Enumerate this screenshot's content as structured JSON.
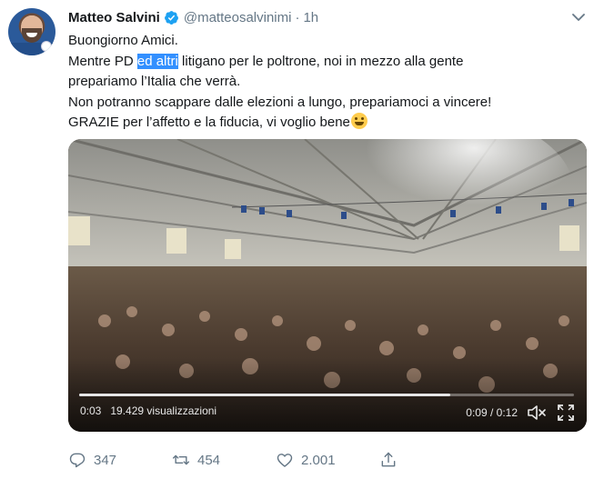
{
  "tweet": {
    "author_name": "Matteo Salvini",
    "handle": "@matteosalvinimi",
    "separator": "·",
    "time": "1h",
    "text": {
      "line1": "Buongiorno Amici.",
      "line2_before": "Mentre PD ",
      "line2_highlight": "ed altri",
      "line2_after": " litigano per le poltrone, noi in mezzo alla gente",
      "line3": "prepariamo l’Italia che verrà.",
      "line4": "Non potranno scappare dalle elezioni a lungo, prepariamoci a vincere!",
      "line5": "GRAZIE per l’affetto e la fiducia, vi voglio bene"
    },
    "emoji": "smiling-face-emoji"
  },
  "video": {
    "current_time": "0:03",
    "views": "19.429 visualizzazioni",
    "position": "0:09 / 0:12",
    "progress_fraction": 0.75
  },
  "actions": {
    "reply_count": "347",
    "retweet_count": "454",
    "like_count": "2.001"
  },
  "colors": {
    "verified": "#1da1f2",
    "secondary_text": "#657786",
    "highlight": "#3390ff"
  }
}
